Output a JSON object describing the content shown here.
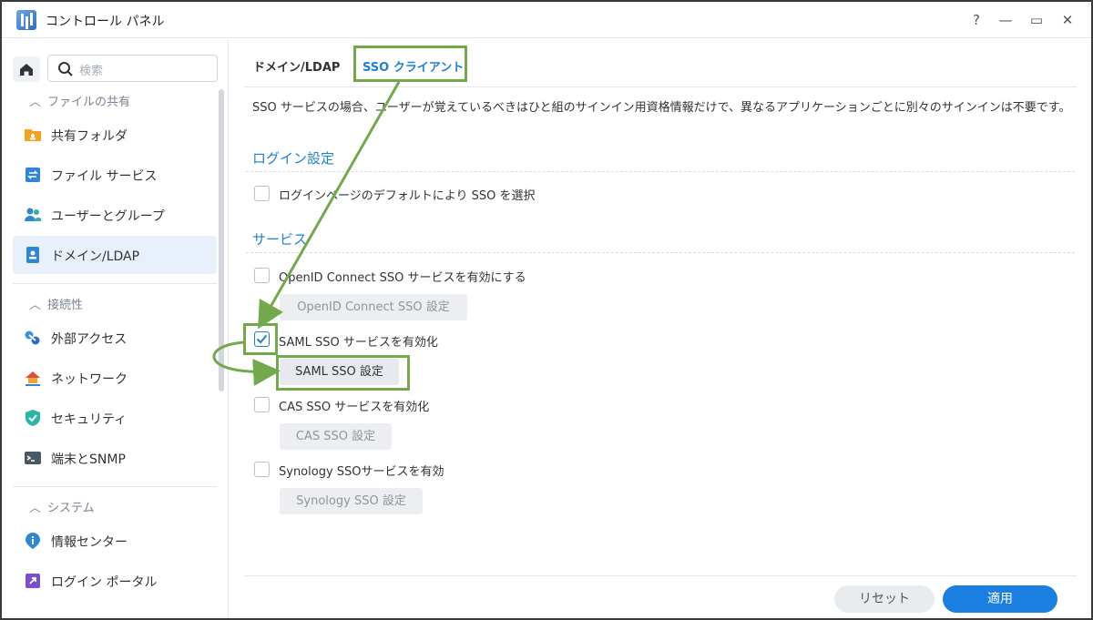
{
  "app": {
    "title": "コントロール パネル"
  },
  "window_controls": {
    "help": "?",
    "minimize": "—",
    "maximize": "▭",
    "close": "✕"
  },
  "search": {
    "placeholder": "検索"
  },
  "sidebar": {
    "groups": [
      {
        "label": "ファイルの共有"
      },
      {
        "label": "接続性"
      },
      {
        "label": "システム"
      }
    ],
    "items": [
      {
        "label": "共有フォルダ",
        "icon": "shared-folder-icon"
      },
      {
        "label": "ファイル サービス",
        "icon": "file-services-icon"
      },
      {
        "label": "ユーザーとグループ",
        "icon": "users-groups-icon"
      },
      {
        "label": "ドメイン/LDAP",
        "icon": "domain-ldap-icon",
        "active": true
      },
      {
        "label": "外部アクセス",
        "icon": "external-access-icon"
      },
      {
        "label": "ネットワーク",
        "icon": "network-icon"
      },
      {
        "label": "セキュリティ",
        "icon": "security-shield-icon"
      },
      {
        "label": "端末とSNMP",
        "icon": "terminal-icon"
      },
      {
        "label": "情報センター",
        "icon": "info-center-icon"
      },
      {
        "label": "ログイン ポータル",
        "icon": "login-portal-icon"
      }
    ]
  },
  "tabs": [
    {
      "label": "ドメイン/LDAP",
      "active": false
    },
    {
      "label": "SSO クライアント",
      "active": true
    }
  ],
  "description": "SSO サービスの場合、ユーザーが覚えているべきはひと組のサインイン用資格情報だけで、異なるアプリケーションごとに別々のサインインは不要です。",
  "login_settings": {
    "title": "ログイン設定",
    "default_sso": {
      "label": "ログインページのデフォルトにより SSO を選択",
      "checked": false
    }
  },
  "services": {
    "title": "サービス",
    "items": [
      {
        "label": "OpenID Connect SSO サービスを有効にする",
        "checked": false,
        "button": "OpenID Connect SSO 設定",
        "button_enabled": false
      },
      {
        "label": "SAML SSO サービスを有効化",
        "checked": true,
        "button": "SAML SSO 設定",
        "button_enabled": true
      },
      {
        "label": "CAS SSO サービスを有効化",
        "checked": false,
        "button": "CAS SSO 設定",
        "button_enabled": false
      },
      {
        "label": "Synology SSOサービスを有効",
        "checked": false,
        "button": "Synology SSO 設定",
        "button_enabled": false
      }
    ]
  },
  "footer": {
    "reset": "リセット",
    "apply": "適用"
  },
  "colors": {
    "accent": "#1e7fd6",
    "annotation": "#73a94b",
    "apply_button": "#1a7fe0"
  }
}
